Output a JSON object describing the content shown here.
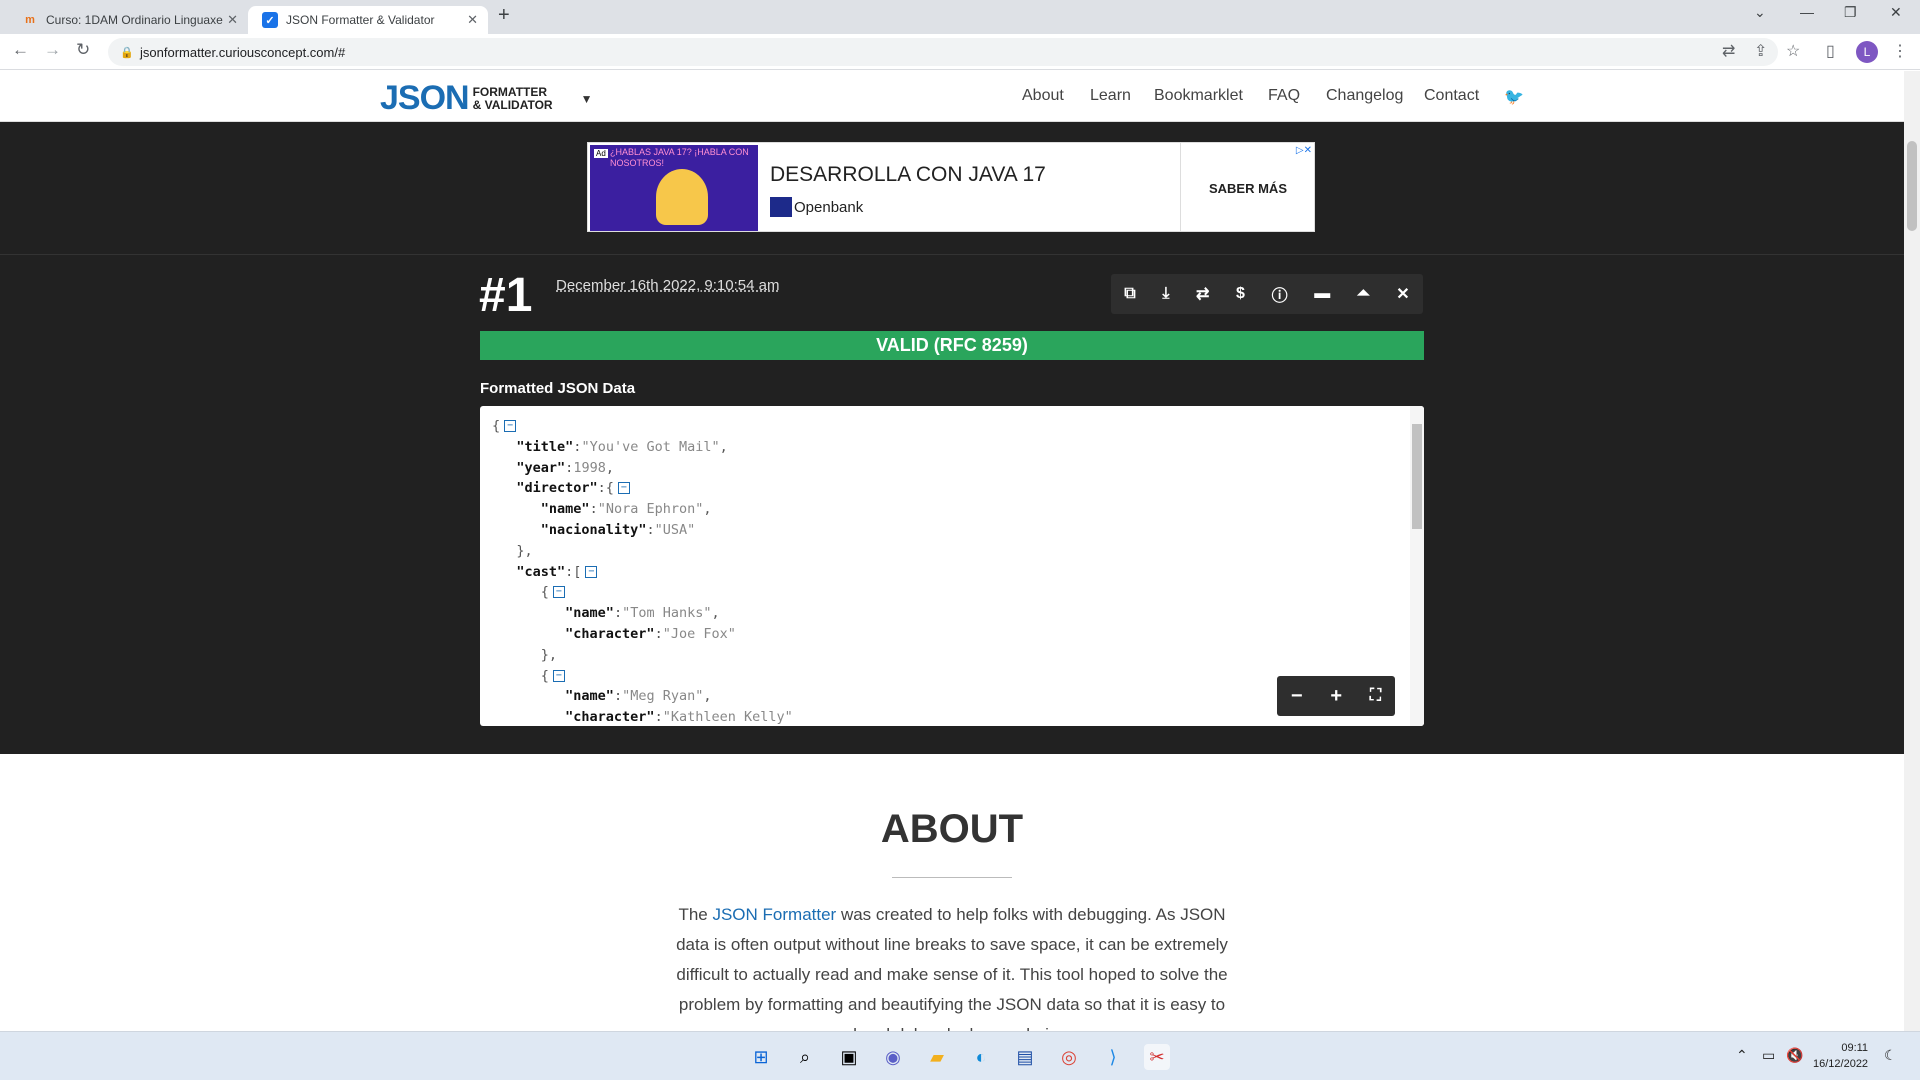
{
  "browser": {
    "tabs": [
      {
        "title": "Curso: 1DAM Ordinario Linguaxe",
        "icon": "moodle-icon"
      },
      {
        "title": "JSON Formatter & Validator",
        "icon": "checkbox-icon"
      }
    ],
    "url": "jsonformatter.curiousconcept.com/#",
    "profile_initial": "L"
  },
  "site": {
    "logo_big": "JSON",
    "logo_small_1": "FORMATTER",
    "logo_small_2": "& VALIDATOR",
    "nav": [
      "About",
      "Learn",
      "Bookmarklet",
      "FAQ",
      "Changelog",
      "Contact"
    ]
  },
  "ad": {
    "image_text": "¿HABLAS JAVA 17? ¡HABLA CON NOSOTROS!",
    "ad_tag": "Ad",
    "headline": "DESARROLLA CON JAVA 17",
    "brand": "Openbank",
    "cta": "SABER MÁS"
  },
  "result": {
    "number": "#1",
    "timestamp": "December 16th 2022, 9:10:54 am",
    "status": "VALID (RFC 8259)",
    "section_label": "Formatted JSON Data",
    "toolbar_icons": [
      "copy-icon",
      "download-icon",
      "refresh-icon",
      "dollar-icon",
      "info-icon",
      "collapse-icon",
      "expand-icon",
      "close-icon"
    ],
    "zoom_icons": [
      "minus-icon",
      "plus-icon",
      "fullscreen-icon"
    ]
  },
  "code": {
    "title_key": "\"title\"",
    "title_val": "\"You've Got Mail\"",
    "year_key": "\"year\"",
    "year_val": "1998",
    "director_key": "\"director\"",
    "dname_key": "\"name\"",
    "dname_val": "\"Nora Ephron\"",
    "nat_key": "\"nacionality\"",
    "nat_val": "\"USA\"",
    "cast_key": "\"cast\"",
    "c1_name_key": "\"name\"",
    "c1_name_val": "\"Tom Hanks\"",
    "c1_char_key": "\"character\"",
    "c1_char_val": "\"Joe Fox\"",
    "c2_name_key": "\"name\"",
    "c2_name_val": "\"Meg Ryan\"",
    "c2_char_key": "\"character\"",
    "c2_char_val": "\"Kathleen Kelly\""
  },
  "about": {
    "heading": "ABOUT",
    "p_before": "The ",
    "p_link": "JSON Formatter",
    "p_after": " was created to help folks with debugging. As JSON data is often output without line breaks to save space, it can be extremely difficult to actually read and make sense of it. This tool hoped to solve the problem by formatting and beautifying the JSON data so that it is easy to read and debug by human beings."
  },
  "taskbar": {
    "time": "09:11",
    "date": "16/12/2022"
  }
}
